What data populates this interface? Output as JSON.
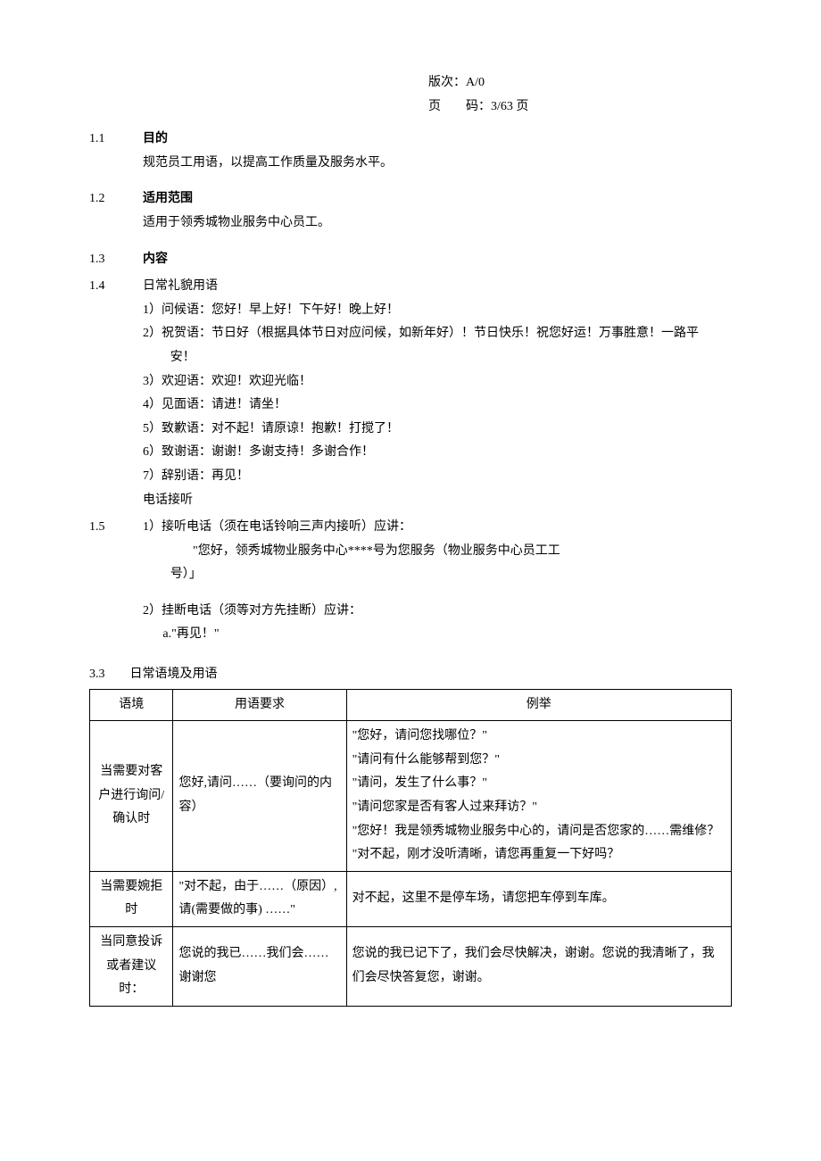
{
  "meta": {
    "version_label": "版次：",
    "version_value": "A/0",
    "page_label": "页　　码：",
    "page_value": "3/63 页"
  },
  "s11": {
    "num": "1.1",
    "title": "目的",
    "body": "规范员工用语，以提高工作质量及服务水平。"
  },
  "s12": {
    "num": "1.2",
    "title": "适用范围",
    "body": "适用于领秀城物业服务中心员工。"
  },
  "s13": {
    "num": "1.3",
    "title": "内容"
  },
  "s14": {
    "num": "1.4",
    "title": "日常礼貌用语",
    "items": {
      "i1": "1）问候语：您好！早上好！下午好！晚上好！",
      "i2a": "2）祝贺语：节日好（根据具体节日对应问候，如新年好）！节日快乐！祝您好运！万事胜意！一路平",
      "i2b": "安！",
      "i3": "3）欢迎语：欢迎！欢迎光临！",
      "i4": "4）见面语：请进！请坐！",
      "i5": "5）致歉语：对不起！请原谅！抱歉！打搅了！",
      "i6": "6）致谢语：谢谢！多谢支持！多谢合作！",
      "i7": "7）辞别语：再见！",
      "tel": "电话接听"
    }
  },
  "s15": {
    "num": "1.5",
    "l1": "1）接听电话（须在电话铃响三声内接听）应讲：",
    "l1q": "\"您好，领秀城物业服务中心****号为您服务（物业服务中心员工工",
    "l1q2": "号）」",
    "l2": "2）挂断电话（须等对方先挂断）应讲：",
    "l2a": "a.\"再见！\""
  },
  "s33": {
    "num": "3.3",
    "title": "日常语境及用语",
    "headers": {
      "h1": "语境",
      "h2": "用语要求",
      "h3": "例举"
    },
    "rows": {
      "r1": {
        "ctx": "当需要对客户进行询问/确认时",
        "req": "您好,请问……（要询问的内容）",
        "ex": {
          "e1": "\"您好，请问您找哪位？\"",
          "e2": "\"请问有什么能够帮到您？\"",
          "e3": "\"请问，发生了什么事？\"",
          "e4": "\"请问您家是否有客人过来拜访？\"",
          "e5": "\"您好！我是领秀城物业服务中心的，请问是否您家的……需维修？",
          "e6": "\"对不起，刚才没听清晰，请您再重复一下好吗？"
        }
      },
      "r2": {
        "ctx": "当需要婉拒时",
        "req": "\"对不起，由于……（原因）,请(需要做的事) ……\"",
        "ex": "对不起，这里不是停车场，请您把车停到车库。"
      },
      "r3": {
        "ctx": "当同意投诉或者建议时：",
        "req": "您说的我已……我们会……谢谢您",
        "ex": "您说的我已记下了，我们会尽快解决，谢谢。您说的我清晰了，我们会尽快答复您，谢谢。"
      }
    }
  }
}
